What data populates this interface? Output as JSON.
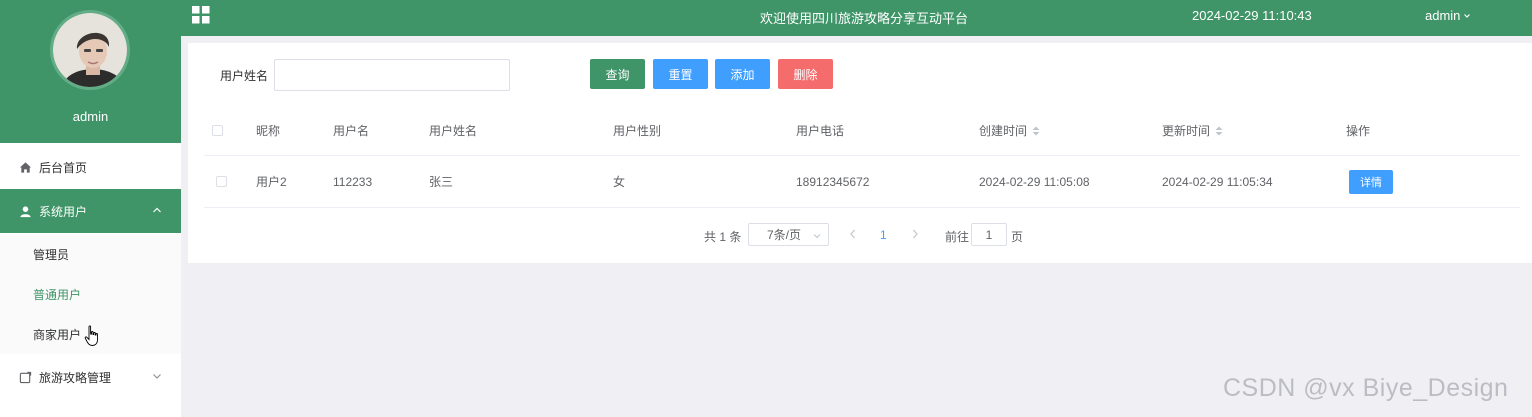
{
  "sidebar": {
    "username": "admin",
    "menu": [
      {
        "label": "后台首页",
        "icon": "home-icon"
      },
      {
        "label": "系统用户",
        "icon": "user-icon",
        "expanded": true
      },
      {
        "label": "旅游攻略管理",
        "icon": "document-icon"
      }
    ],
    "submenu": [
      {
        "label": "管理员"
      },
      {
        "label": "普通用户"
      },
      {
        "label": "商家用户"
      }
    ]
  },
  "header": {
    "title": "欢迎使用四川旅游攻略分享互动平台",
    "datetime": "2024-02-29 11:10:43",
    "user": "admin"
  },
  "search": {
    "label": "用户姓名",
    "value": "",
    "buttons": {
      "query": "查询",
      "reset": "重置",
      "add": "添加",
      "delete": "删除"
    }
  },
  "table": {
    "columns": [
      "昵称",
      "用户名",
      "用户姓名",
      "用户性别",
      "用户电话",
      "创建时间",
      "更新时间",
      "操作"
    ],
    "rows": [
      {
        "nickname": "用户2",
        "username": "112233",
        "realname": "张三",
        "gender": "女",
        "phone": "18912345672",
        "created": "2024-02-29 11:05:08",
        "updated": "2024-02-29 11:05:34",
        "action": "详情"
      }
    ]
  },
  "pagination": {
    "total": "共 1 条",
    "page_size": "7条/页",
    "current_page": "1",
    "goto_label": "前往",
    "goto_value": "1",
    "goto_suffix": "页"
  },
  "watermark": "CSDN @vx Biye_Design",
  "colors": {
    "primary_green": "#3f9468",
    "blue": "#409eff",
    "red": "#f56c6c"
  }
}
